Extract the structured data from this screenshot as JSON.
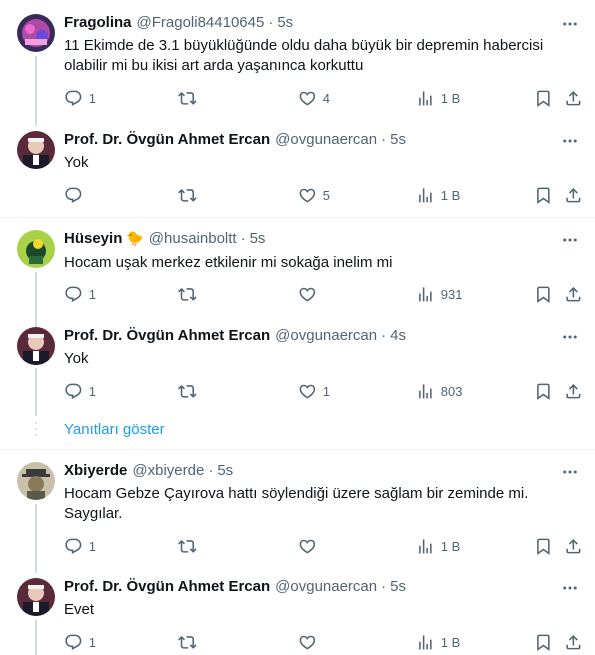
{
  "colors": {
    "accent": "#1d9bf0",
    "muted": "#536471",
    "text": "#0f1419",
    "divider": "#eff3f4"
  },
  "threads": [
    {
      "tweet": {
        "name": "Fragolina",
        "handle": "@Fragoli84410645",
        "time": "5s",
        "text": "11 Ekimde  de 3.1 büyüklüğünde oldu daha büyük bir depremin habercisi olabilir mi bu ikisi art arda  yaşanınca korkuttu",
        "replies": "1",
        "retweets": "",
        "likes": "4",
        "views": "1 B"
      },
      "reply": {
        "name": "Prof. Dr. Övgün Ahmet Ercan",
        "handle": "@ovgunaercan",
        "time": "5s",
        "text": "Yok",
        "replies": "",
        "retweets": "",
        "likes": "5",
        "views": "1 B"
      }
    },
    {
      "tweet": {
        "name": "Hüseyin",
        "emoji": "🐤",
        "handle": "@husainboltt",
        "time": "5s",
        "text": "Hocam uşak merkez etkilenir mi sokağa inelim mi",
        "replies": "1",
        "retweets": "",
        "likes": "",
        "views": "931"
      },
      "reply": {
        "name": "Prof. Dr. Övgün Ahmet Ercan",
        "handle": "@ovgunaercan",
        "time": "4s",
        "text": "Yok",
        "replies": "1",
        "retweets": "",
        "likes": "1",
        "views": "803"
      },
      "show_replies": "Yanıtları göster"
    },
    {
      "tweet": {
        "name": "Xbiyerde",
        "handle": "@xbiyerde",
        "time": "5s",
        "text": "Hocam Gebze Çayırova hattı söylendiği üzere sağlam bir zeminde mi. Saygılar.",
        "replies": "1",
        "retweets": "",
        "likes": "",
        "views": "1 B"
      },
      "reply": {
        "name": "Prof. Dr. Övgün Ahmet Ercan",
        "handle": "@ovgunaercan",
        "time": "5s",
        "text": "Evet",
        "replies": "1",
        "retweets": "",
        "likes": "",
        "views": "1 B"
      }
    }
  ]
}
